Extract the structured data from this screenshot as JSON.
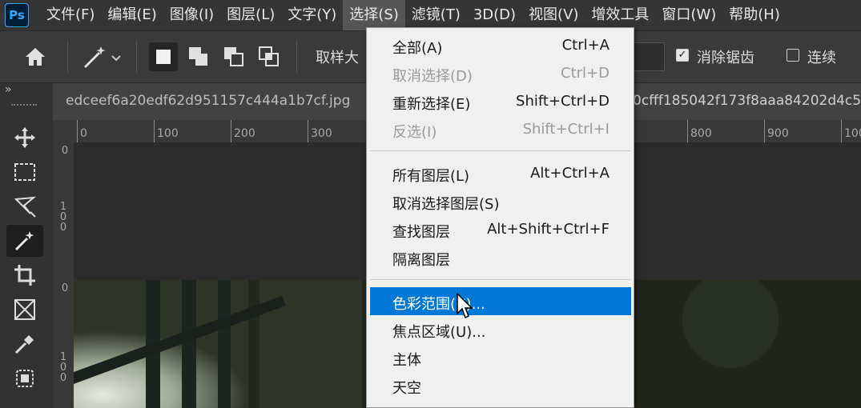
{
  "menubar": {
    "logo": "Ps",
    "items": [
      "文件(F)",
      "编辑(E)",
      "图像(I)",
      "图层(L)",
      "文字(Y)",
      "选择(S)",
      "滤镜(T)",
      "3D(D)",
      "视图(V)",
      "增效工具",
      "窗口(W)",
      "帮助(H)"
    ]
  },
  "options_bar": {
    "sample_size_label": "取样大",
    "antialias_label": "消除锯齿",
    "antialias_checked": true,
    "contiguous_label": "连续",
    "contiguous_checked": false
  },
  "document": {
    "tab_name": "edceef6a20edf62d951157c444a1b7cf.jpg",
    "tab_name_partial": "0cfff185042f173f8aaa84202d4c5"
  },
  "ruler": {
    "h_ticks": [
      "0",
      "100",
      "200",
      "300",
      "800",
      "900",
      "100"
    ],
    "v_ticks": [
      "0",
      "1 0 0",
      "0",
      "1 0 0"
    ]
  },
  "select_menu": {
    "items": [
      {
        "label": "全部(A)",
        "shortcut": "Ctrl+A",
        "disabled": false
      },
      {
        "label": "取消选择(D)",
        "shortcut": "Ctrl+D",
        "disabled": true
      },
      {
        "label": "重新选择(E)",
        "shortcut": "Shift+Ctrl+D",
        "disabled": false
      },
      {
        "label": "反选(I)",
        "shortcut": "Shift+Ctrl+I",
        "disabled": true
      },
      {
        "label": "所有图层(L)",
        "shortcut": "Alt+Ctrl+A",
        "disabled": false
      },
      {
        "label": "取消选择图层(S)",
        "shortcut": "",
        "disabled": false
      },
      {
        "label": "查找图层",
        "shortcut": "Alt+Shift+Ctrl+F",
        "disabled": false
      },
      {
        "label": "隔离图层",
        "shortcut": "",
        "disabled": false
      },
      {
        "label": "色彩范围(C)...",
        "shortcut": "",
        "disabled": false,
        "highlighted": true
      },
      {
        "label": "焦点区域(U)...",
        "shortcut": "",
        "disabled": false
      },
      {
        "label": "主体",
        "shortcut": "",
        "disabled": false
      },
      {
        "label": "天空",
        "shortcut": "",
        "disabled": false
      }
    ]
  },
  "colors": {
    "highlight": "#0078d7",
    "ps_logo_text": "#31a8ff",
    "ps_logo_bg": "#001e36"
  }
}
